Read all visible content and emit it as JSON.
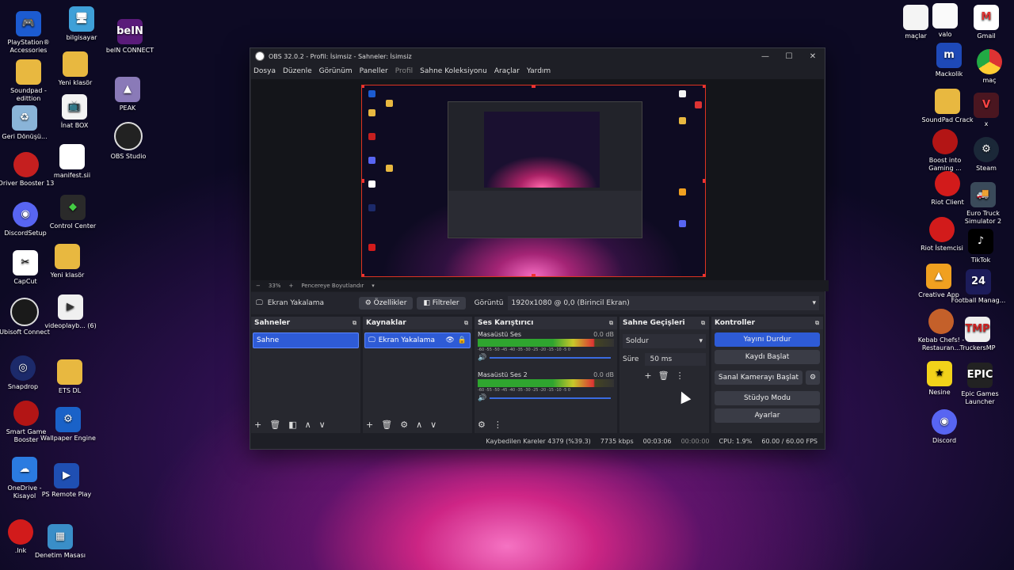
{
  "desktop": {
    "left_col1": [
      "PlayStation® Accessories",
      "Soundpad - edittion",
      "Geri Dönüşü...",
      "Driver Booster 13",
      "DiscordSetup",
      "CapCut",
      "Ubisoft Connect",
      "Snapdrop",
      "Smart Game Booster",
      "OneDrive - Kisayol",
      ".lnk"
    ],
    "left_col2": [
      "bilgisayar",
      "Yeni klasör",
      "İnat BOX",
      "manifest.sii",
      "Control Center",
      "Yeni klasör",
      "videoplayb... (6)",
      "ETS DL",
      "Wallpaper Engine",
      "PS Remote Play",
      "Denetim Masası"
    ],
    "left_col3": [
      "beIN CONNECT",
      "PEAK",
      "OBS Studio"
    ],
    "right_col1": [
      "maçlar",
      "Mackolik",
      "SoundPad Crack",
      "Boost into Gaming ...",
      "Riot Client",
      "Riot İstemcisi",
      "Creative App",
      "Kebab Chefs! - Restauran...",
      "Nesine",
      "Discord"
    ],
    "right_col2": [
      "valo",
      "Gmail",
      "maç",
      "x",
      "Steam",
      "Euro Truck Simulator 2",
      "TikTok",
      "Football Manag...",
      "TruckersMP",
      "Epic Games Launcher"
    ]
  },
  "obs": {
    "title": "OBS 32.0.2 - Profil: İsimsiz - Sahneler: İsimsiz",
    "menu": [
      "Dosya",
      "Düzenle",
      "Görünüm",
      "Paneller",
      "Profil",
      "Sahne Koleksiyonu",
      "Araçlar",
      "Yardım"
    ],
    "zoom": {
      "percent": "33%",
      "fit_label": "Pencereye Boyutlandır"
    },
    "source_bar": {
      "source": "Ekran Yakalama",
      "properties": "Özellikler",
      "filters": "Filtreler",
      "display_label": "Görüntü",
      "display_value": "1920x1080 @ 0,0 (Birincil Ekran)"
    },
    "docks": {
      "scenes": {
        "title": "Sahneler",
        "items": [
          "Sahne"
        ]
      },
      "sources": {
        "title": "Kaynaklar",
        "items": [
          "Ekran Yakalama"
        ]
      },
      "mixer": {
        "title": "Ses Karıştırıcı",
        "channels": [
          {
            "name": "Masaüstü Ses",
            "db": "0.0 dB"
          },
          {
            "name": "Masaüstü Ses 2",
            "db": "0.0 dB"
          }
        ],
        "scale": "-60 -55 -50 -45 -40 -35 -30 -25 -20 -15 -10 -5 0"
      },
      "transitions": {
        "title": "Sahne Geçişleri",
        "type": "Soldur",
        "duration_label": "Süre",
        "duration": "50 ms"
      },
      "controls": {
        "title": "Kontroller",
        "buttons": [
          "Yayını Durdur",
          "Kaydı Başlat",
          "Sanal Kamerayı Başlat",
          "Stüdyo Modu",
          "Ayarlar"
        ]
      }
    },
    "status": {
      "dropped": "Kaybedilen Kareler 4379 (%39.3)",
      "bitrate": "7735 kbps",
      "stream_time": "00:03:06",
      "rec_time": "00:00:00",
      "cpu": "CPU: 1.9%",
      "fps": "60.00 / 60.00 FPS"
    }
  }
}
